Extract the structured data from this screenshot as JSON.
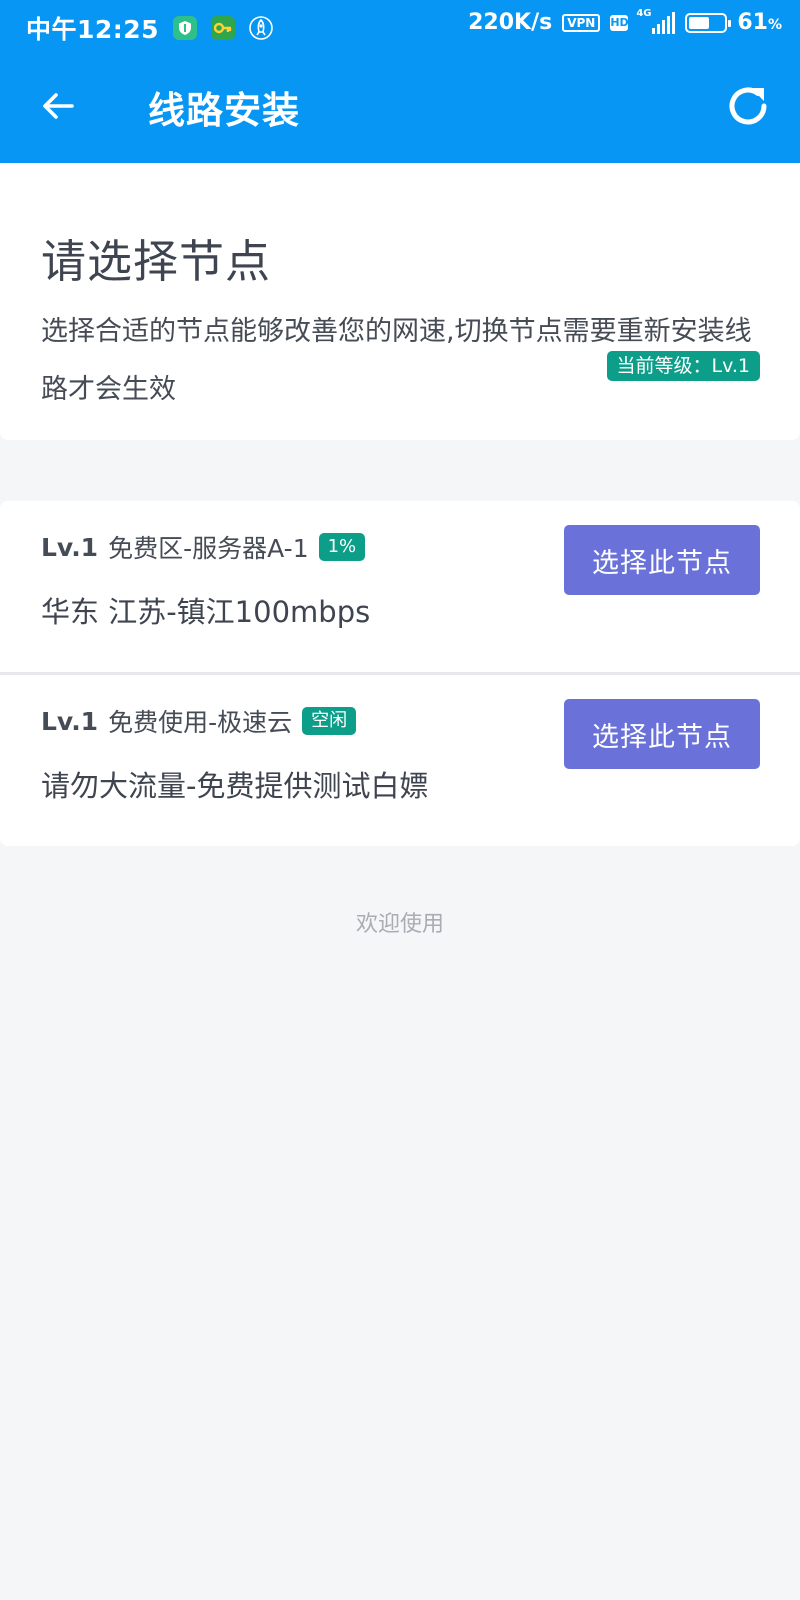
{
  "status_bar": {
    "time": "中午12:25",
    "net_speed": "220K/s",
    "vpn_label": "VPN",
    "hd_label": "HD",
    "network_type": "4G",
    "battery_percent": "61",
    "battery_unit": "%",
    "battery_level": 0.61
  },
  "app_bar": {
    "title": "线路安装"
  },
  "intro": {
    "title": "请选择节点",
    "description": "选择合适的节点能够改善您的网速,切换节点需要重新安装线路才会生效",
    "level_badge": "当前等级：Lv.1"
  },
  "nodes": [
    {
      "level": "Lv.1",
      "name": "免费区-服务器A-1",
      "tag": "1%",
      "description": "华东 江苏-镇江100mbps",
      "button_label": "选择此节点"
    },
    {
      "level": "Lv.1",
      "name": "免费使用-极速云",
      "tag": "空闲",
      "description": "请勿大流量-免费提供测试白嫖",
      "button_label": "选择此节点"
    }
  ],
  "footer": {
    "welcome": "欢迎使用"
  },
  "colors": {
    "primary": "#0796F3",
    "button": "#6A71D8",
    "badge": "#0D9E8A",
    "background": "#F5F6F8"
  }
}
